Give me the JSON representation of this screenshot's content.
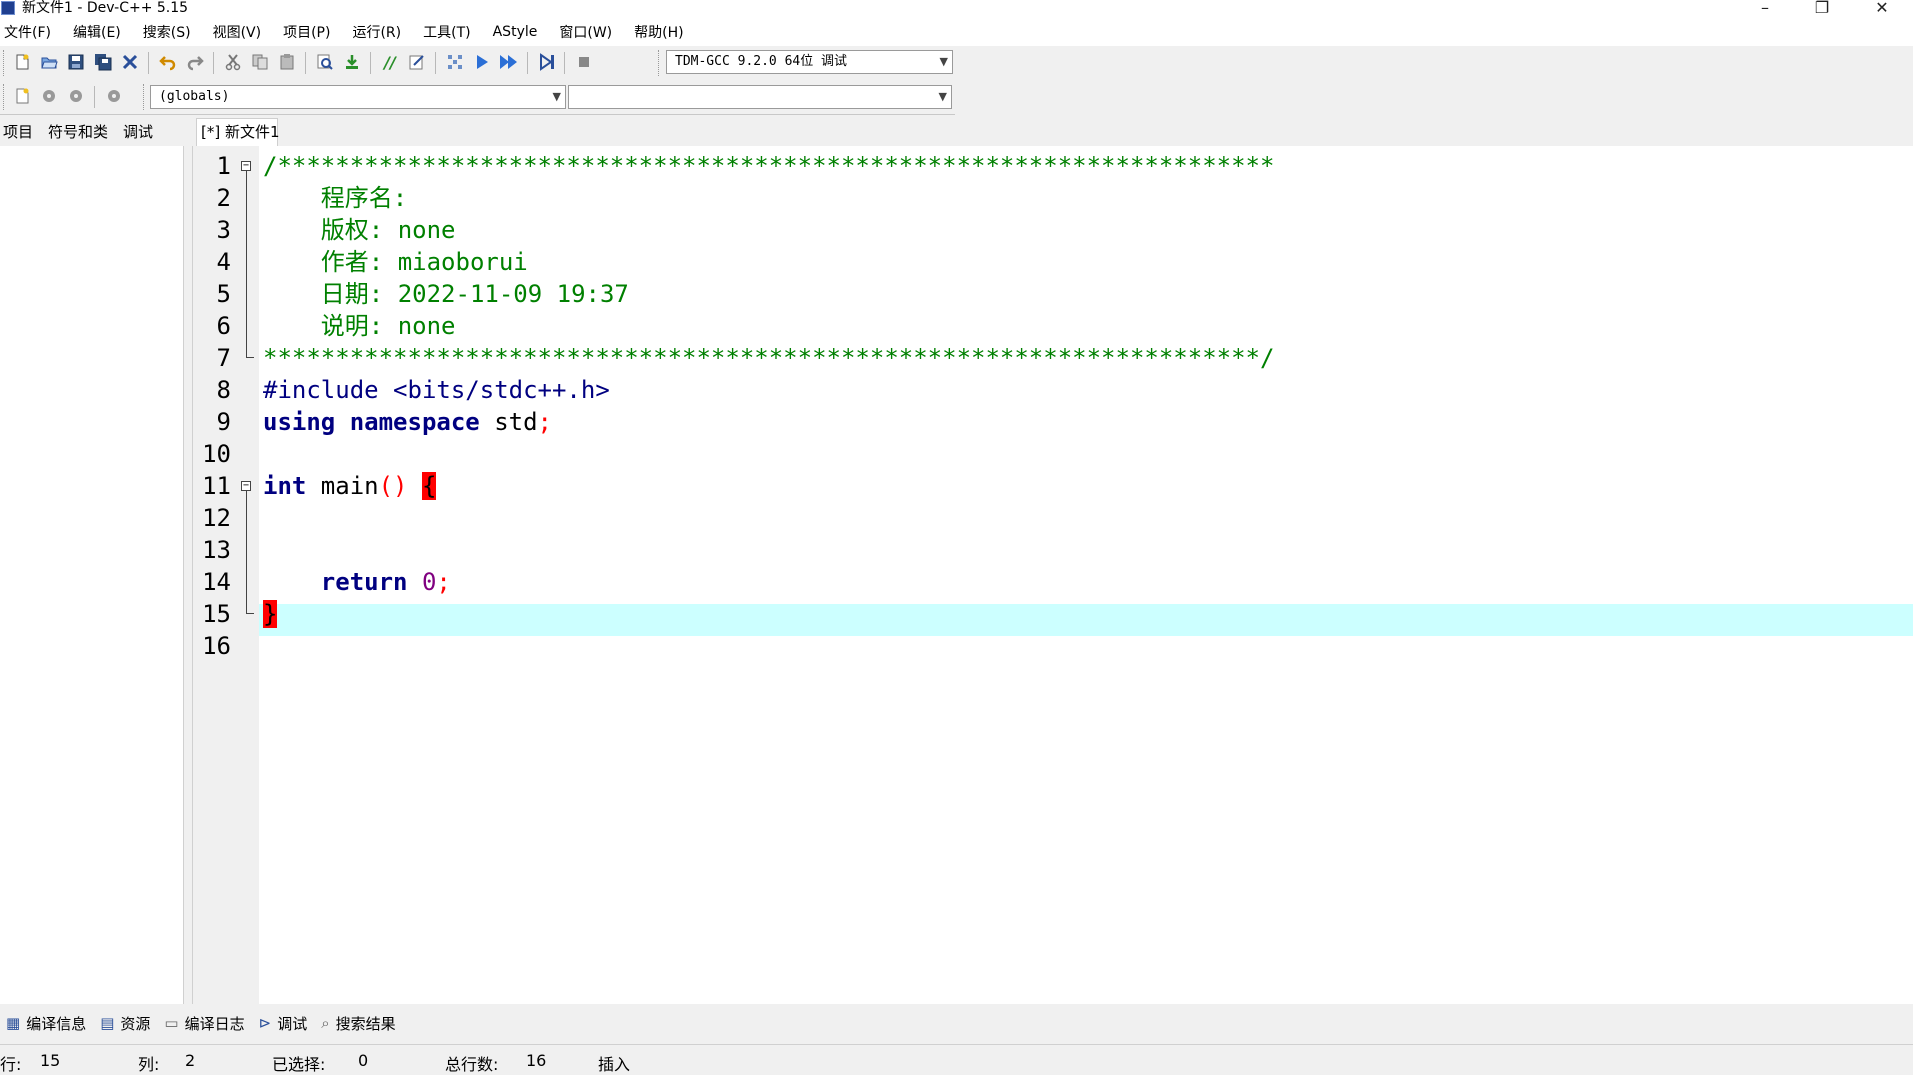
{
  "window": {
    "title": "新文件1 - Dev-C++ 5.15",
    "minimize": "–",
    "restore": "❐",
    "close": "✕"
  },
  "menu": [
    "文件(F)",
    "编辑(E)",
    "搜索(S)",
    "视图(V)",
    "项目(P)",
    "运行(R)",
    "工具(T)",
    "AStyle",
    "窗口(W)",
    "帮助(H)"
  ],
  "toolbar": {
    "compiler": "TDM-GCC 9.2.0 64位 调试",
    "scope": "(globals)",
    "symbol": ""
  },
  "left_tabs": [
    "项目",
    "符号和类",
    "调试"
  ],
  "editor_tab": "[*] 新文件1",
  "code": {
    "l1": "/*********************************************************************",
    "l2": "    程序名:",
    "l3": "    版权: none",
    "l4": "    作者: miaoborui",
    "l5": "    日期: 2022-11-09 19:37",
    "l6": "    说明: none",
    "l7": "*********************************************************************/",
    "l8": "#include <bits/stdc++.h>",
    "l9_kw": "using namespace",
    "l9_id": " std",
    "l9_semi": ";",
    "l11_kw": "int",
    "l11_fn": " main",
    "l11_paren": "()",
    "l11_brace": "{",
    "l14_kw": "return",
    "l14_num": "0",
    "l14_semi": ";",
    "l15_brace": "}"
  },
  "line_numbers": [
    "1",
    "2",
    "3",
    "4",
    "5",
    "6",
    "7",
    "8",
    "9",
    "10",
    "11",
    "12",
    "13",
    "14",
    "15",
    "16"
  ],
  "bottom_tabs": [
    {
      "icon": "compile-info-icon",
      "label": "编译信息"
    },
    {
      "icon": "resources-icon",
      "label": "资源"
    },
    {
      "icon": "compile-log-icon",
      "label": "编译日志"
    },
    {
      "icon": "debug-icon",
      "label": "调试"
    },
    {
      "icon": "search-results-icon",
      "label": "搜索结果"
    }
  ],
  "status": {
    "row_label": "行:",
    "row_value": "15",
    "col_label": "列:",
    "col_value": "2",
    "sel_label": "已选择:",
    "sel_value": "0",
    "total_label": "总行数:",
    "total_value": "16",
    "mode": "插入"
  },
  "colors": {
    "comment": "#008000",
    "keyword": "#000080",
    "active_line": "#ccffff",
    "brace_match": "#ff0000"
  }
}
